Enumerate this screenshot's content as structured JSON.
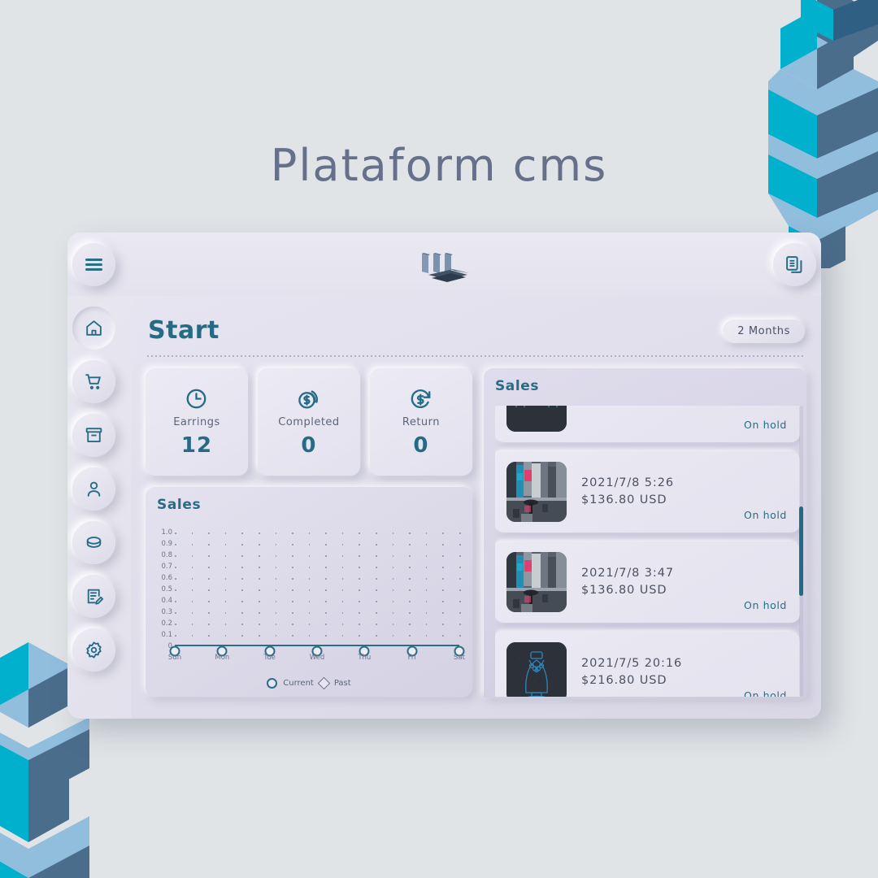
{
  "hero": {
    "title": "Plataform cms"
  },
  "colors": {
    "accent_teal": "#266b83",
    "text_muted": "#5e6479",
    "bg_page": "#e1e4e6",
    "panel": "#e6e4f0",
    "deco_cyan": "#00b0cc",
    "deco_slate": "#4a6d8c",
    "deco_light": "#92bede"
  },
  "topbar": {
    "menu_button": "menu",
    "logo_name": "plataform-logo",
    "docs_button": "documents"
  },
  "sidebar": {
    "items": [
      {
        "name": "home",
        "label": "Home",
        "active": true
      },
      {
        "name": "cart",
        "label": "Orders",
        "active": false
      },
      {
        "name": "archive",
        "label": "Archive",
        "active": false
      },
      {
        "name": "user",
        "label": "Customers",
        "active": false
      },
      {
        "name": "coin",
        "label": "Payments",
        "active": false
      },
      {
        "name": "edit-doc",
        "label": "Reports",
        "active": false
      },
      {
        "name": "settings",
        "label": "Settings",
        "active": false
      }
    ]
  },
  "page": {
    "title": "Start",
    "period_selector": "2 Months"
  },
  "stats": [
    {
      "icon": "clock-icon",
      "label": "Earrings",
      "value": "12"
    },
    {
      "icon": "coins-icon",
      "label": "Completed",
      "value": "0"
    },
    {
      "icon": "refresh-money-icon",
      "label": "Return",
      "value": "0"
    }
  ],
  "sales_chart": {
    "title": "Sales"
  },
  "chart_data": {
    "type": "line",
    "title": "Sales",
    "categories": [
      "Sun",
      "Mon",
      "Tue",
      "Wed",
      "Thu",
      "Fri",
      "Sat"
    ],
    "series": [
      {
        "name": "Current",
        "marker": "circle",
        "values": [
          0,
          0,
          0,
          0,
          0,
          0,
          0
        ]
      },
      {
        "name": "Past",
        "marker": "diamond",
        "values": []
      }
    ],
    "yticks": [
      "1.0",
      "0.9",
      "0.8",
      "0.7",
      "0.6",
      "0.5",
      "0.4",
      "0.3",
      "0.2",
      "0.1",
      "0"
    ],
    "ylim": [
      0,
      1.0
    ],
    "xlabel": "",
    "ylabel": "",
    "grid": true,
    "legend": [
      "Current",
      "Past"
    ],
    "legend_position": "bottom-center"
  },
  "sales_list": {
    "title": "Sales",
    "items": [
      {
        "thumb": "furniture-outline",
        "date": "",
        "amount": "",
        "status": "On hold",
        "partial": true
      },
      {
        "thumb": "city-street-photo",
        "date": "2021/7/8 5:26",
        "amount": "$136.80 USD",
        "status": "On hold"
      },
      {
        "thumb": "city-street-photo",
        "date": "2021/7/8 3:47",
        "amount": "$136.80 USD",
        "status": "On hold"
      },
      {
        "thumb": "necklace-outline",
        "date": "2021/7/5 20:16",
        "amount": "$216.80 USD",
        "status": "On hold"
      }
    ]
  }
}
